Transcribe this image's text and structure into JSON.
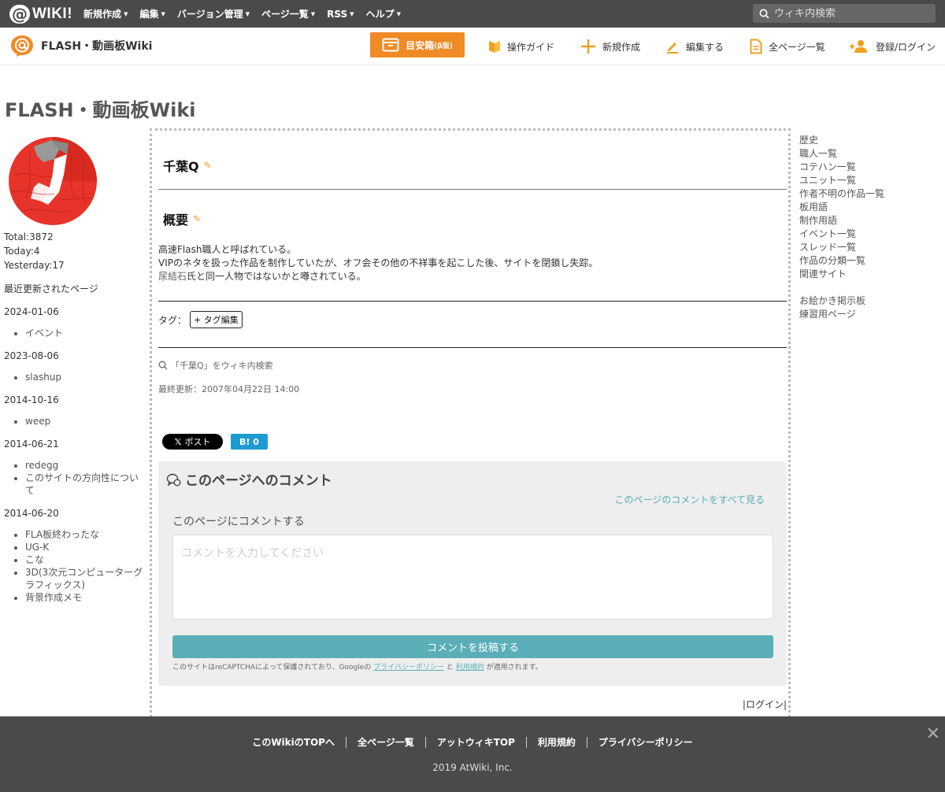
{
  "topbar": {
    "logo_text": "WIKI!",
    "menu": [
      "新規作成",
      "編集",
      "バージョン管理",
      "ページ一覧",
      "RSS",
      "ヘルプ"
    ],
    "search_placeholder": "ウィキ内検索"
  },
  "subbar": {
    "site_name": "FLASH・動画板Wiki",
    "guide_label": "目安箱",
    "guide_small": "β版",
    "nav": [
      "操作ガイド",
      "新規作成",
      "編集する",
      "全ページ一覧",
      "登録/ログイン"
    ]
  },
  "page_title": "FLASH・動画板Wiki",
  "left": {
    "counter": [
      "Total:3872",
      "Today:4",
      "Yesterday:17"
    ],
    "recent_title": "最近更新されたページ",
    "groups": [
      {
        "date": "2024-01-06",
        "items": [
          "イベント"
        ]
      },
      {
        "date": "2023-08-06",
        "items": [
          "slashup"
        ]
      },
      {
        "date": "2014-10-16",
        "items": [
          "weep"
        ]
      },
      {
        "date": "2014-06-21",
        "items": [
          "redegg",
          "このサイトの方向性について"
        ]
      },
      {
        "date": "2014-06-20",
        "items": [
          "FLA板終わったな",
          "UG-K",
          "こな",
          "3D(3次元コンピューターグラフィックス)",
          "背景作成メモ"
        ]
      }
    ]
  },
  "main": {
    "heading": "千葉Q",
    "section": "概要",
    "lines": [
      "高速Flash職人と呼ばれている。",
      "VIPのネタを扱った作品を制作していたが、オフ会その他の不祥事を起こした後、サイトを閉鎖し失踪。"
    ],
    "line3_link": "尿結石",
    "line3_rest": "氏と同一人物ではないかと噂されている。",
    "tag_label": "タグ：",
    "tag_button": "+ タグ編集",
    "search_wiki": "「千葉Q」をウィキ内検索",
    "last_updated": "最終更新：2007年04月22日 14:00",
    "share_x": "ポスト",
    "share_b": "B! 0"
  },
  "comments": {
    "title": "このページへのコメント",
    "see_all": "このページのコメントをすべて見る",
    "sub": "このページにコメントする",
    "placeholder": "コメントを入力してください",
    "submit": "コメントを投稿する",
    "recaptcha_pre": "このサイトはreCAPTCHAによって保護されており、Googleの",
    "privacy": "プライバシーポリシー",
    "and": "と",
    "terms": "利用規約",
    "recaptcha_post": "が適用されます。",
    "login": "|ログイン|"
  },
  "right": {
    "items": [
      "歴史",
      "職人一覧",
      "コテハン一覧",
      "ユニット一覧",
      "作者不明の作品一覧",
      "板用語",
      "制作用語",
      "イベント一覧",
      "スレッド一覧",
      "作品の分類一覧",
      "関連サイト"
    ],
    "items2": [
      "お絵かき掲示板",
      "練習用ページ"
    ]
  },
  "footer": {
    "links": [
      "このWikiのTOPへ",
      "全ページ一覧",
      "アットウィキTOP",
      "利用規約",
      "プライバシーポリシー"
    ],
    "copyright": "2019 AtWiki, Inc.",
    "close": "✕"
  },
  "colors": {
    "accent": "#f08a24",
    "teal": "#5aaeb8",
    "dark": "#4a4a4a"
  }
}
